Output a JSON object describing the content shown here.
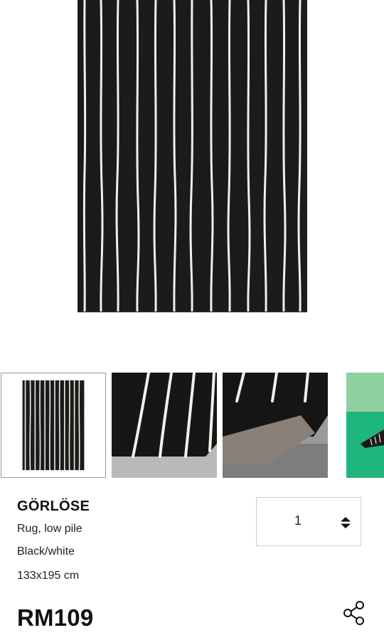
{
  "product": {
    "name": "GÖRLÖSE",
    "description": "Rug, low pile",
    "color": "Black/white",
    "size": "133x195 cm",
    "price": "RM109"
  },
  "quantity": {
    "value": "1"
  },
  "thumbnails": [
    {
      "label": "full-rug-view",
      "selected": true
    },
    {
      "label": "rug-corner-closeup",
      "selected": false
    },
    {
      "label": "rug-underside-corner",
      "selected": false
    },
    {
      "label": "rug-in-room",
      "selected": false
    }
  ],
  "icons": {
    "quantity": "up-down-arrows-icon",
    "share": "share-icon"
  },
  "colors": {
    "rug": "#1b1b1b",
    "stripe": "#f2efe6",
    "floor": "#b9b9b9",
    "room_green": "#1fb67e"
  }
}
